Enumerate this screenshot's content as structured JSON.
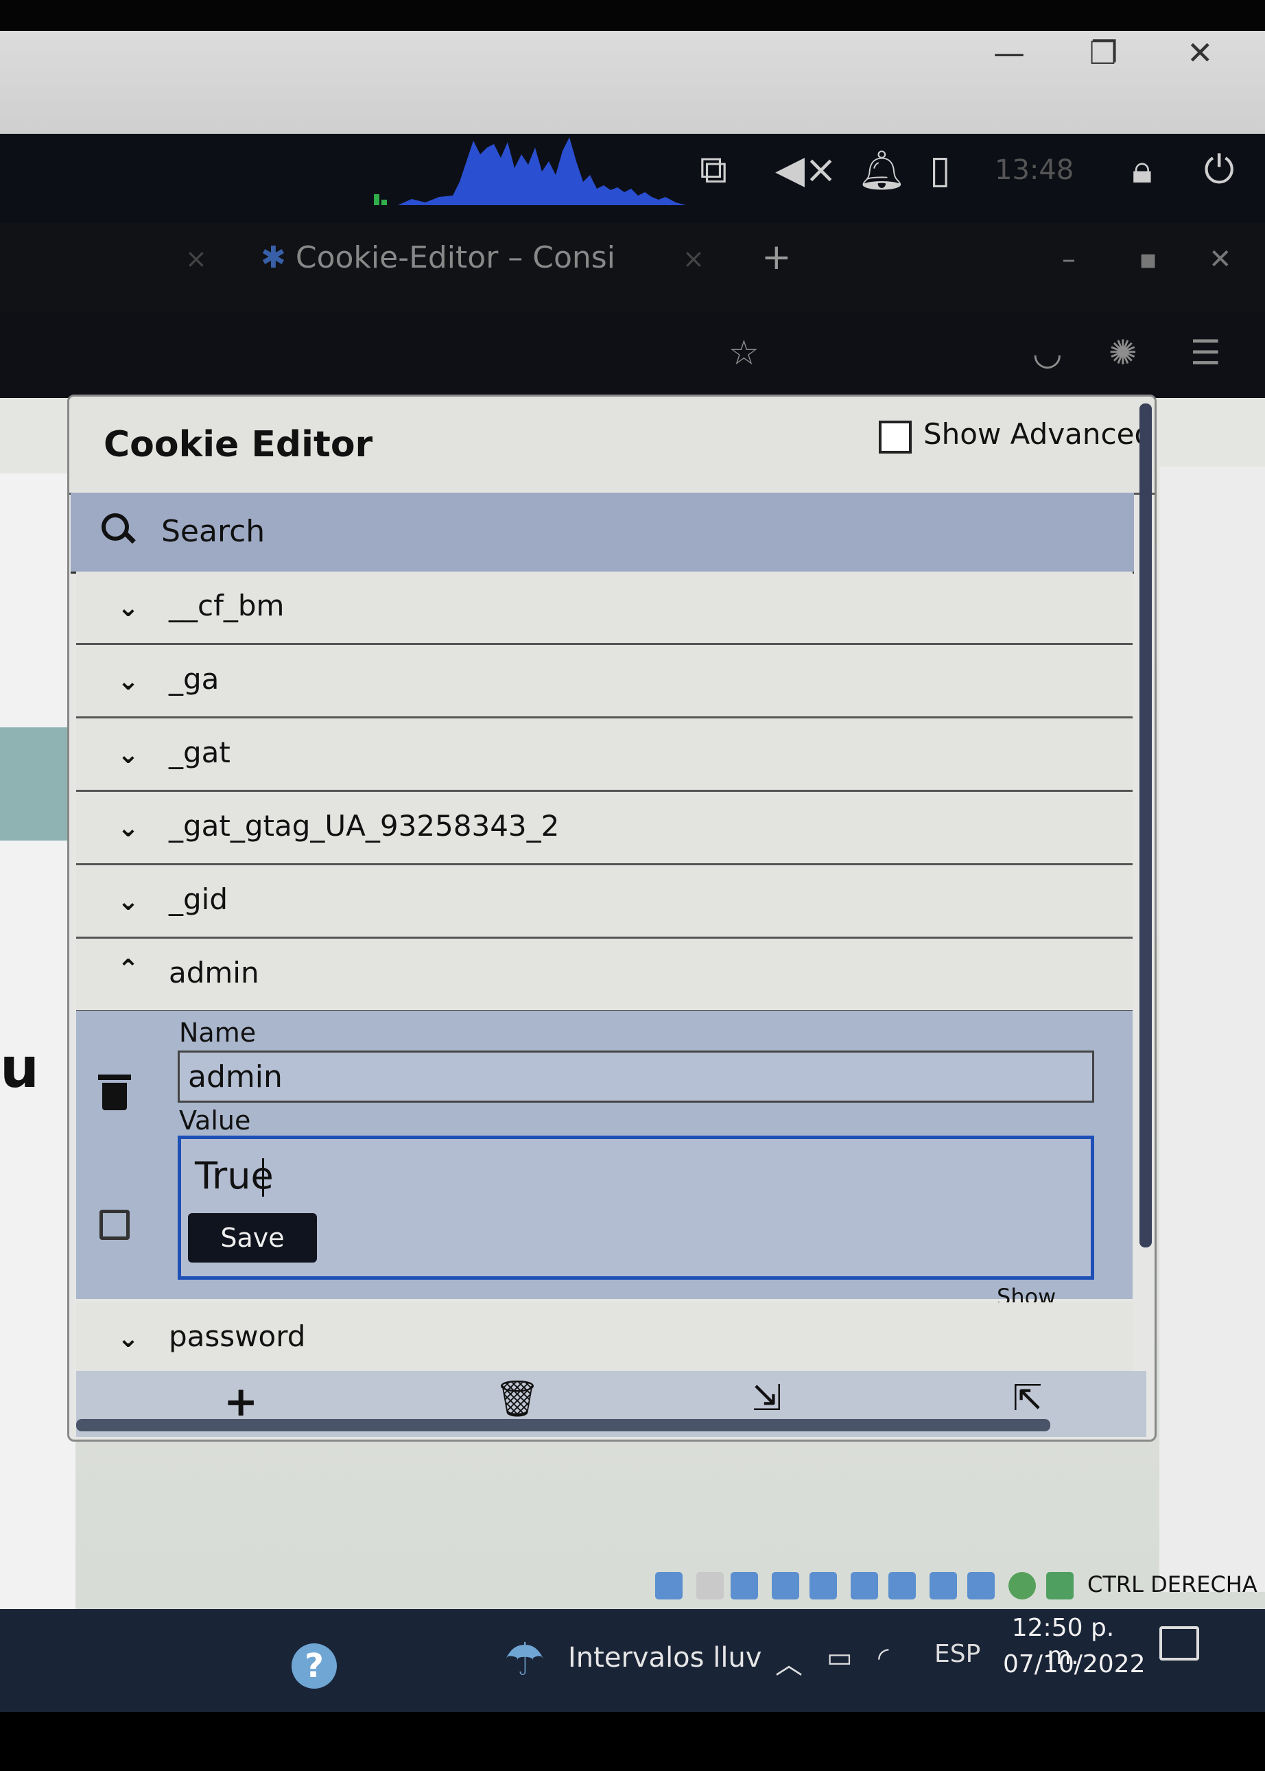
{
  "host_window": {
    "minimize": "—",
    "restore": "❐",
    "close": "✕"
  },
  "panel": {
    "clock": "13:48",
    "icons": [
      "monitor-icon",
      "mute-icon",
      "bell-icon",
      "battery-icon",
      "lock-icon",
      "power-icon"
    ]
  },
  "browser": {
    "tab_title": "Cookie-Editor – Consi",
    "tab_close": "×",
    "new_tab": "+",
    "window_minimize": "–",
    "window_maximize": "▪",
    "window_close": "✕"
  },
  "popup": {
    "title": "Cookie Editor",
    "show_advanced_label": "Show Advanced",
    "show_advanced_checked": false,
    "search_placeholder": "Search",
    "cookies": [
      {
        "name": "__cf_bm",
        "expanded": false
      },
      {
        "name": "_ga",
        "expanded": false
      },
      {
        "name": "_gat",
        "expanded": false
      },
      {
        "name": "_gat_gtag_UA_93258343_2",
        "expanded": false
      },
      {
        "name": "_gid",
        "expanded": false
      },
      {
        "name": "admin",
        "expanded": true
      },
      {
        "name": "password",
        "expanded": false
      }
    ],
    "editor": {
      "name_label": "Name",
      "name_value": "admin",
      "value_label": "Value",
      "value_value": "True",
      "save_label": "Save",
      "show_advanced_link": "Show Advanced"
    },
    "footer": {
      "add": "+",
      "icons": [
        "add-icon",
        "delete-all-icon",
        "import-icon",
        "export-icon"
      ]
    }
  },
  "tray": {
    "label": "CTRL DERECHA"
  },
  "taskbar": {
    "weather": "Intervalos lluv",
    "language": "ESP",
    "time": "12:50 p. m.",
    "date": "07/10/2022",
    "help": "?"
  },
  "colors": {
    "accent_blue": "#1e4fb6",
    "save_button": "#10141f",
    "search_bar": "#9ea9c4",
    "taskbar": "#1a2437"
  }
}
